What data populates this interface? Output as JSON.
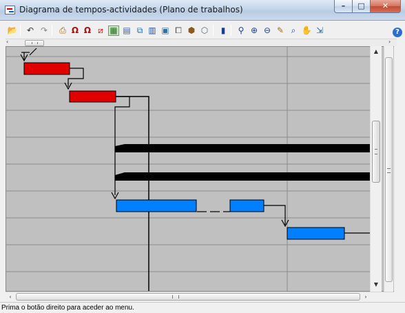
{
  "window": {
    "title": "Diagrama de tempos-actividades (Plano de trabalhos)",
    "minimize_glyph": "–",
    "maximize_glyph": "□",
    "close_glyph": "✕"
  },
  "toolbar": {
    "items": [
      {
        "name": "open-folder-icon",
        "glyph": "📂"
      },
      {
        "name": "undo-icon",
        "glyph": "↶"
      },
      {
        "name": "redo-icon",
        "glyph": "↷"
      },
      {
        "name": "print-icon",
        "glyph": "⎙"
      },
      {
        "name": "link-task-icon",
        "glyph": "Ω"
      },
      {
        "name": "unlink-task-icon",
        "glyph": "Ω"
      },
      {
        "name": "delete-link-icon",
        "glyph": "⧄"
      },
      {
        "name": "gantt-view-icon",
        "glyph": "▦"
      },
      {
        "name": "table-view-icon",
        "glyph": "▤"
      },
      {
        "name": "network-view-icon",
        "glyph": "⧉"
      },
      {
        "name": "histogram-view-icon",
        "glyph": "▥"
      },
      {
        "name": "calendar-icon",
        "glyph": "▣"
      },
      {
        "name": "copy-icon",
        "glyph": "⧠"
      },
      {
        "name": "resources-icon",
        "glyph": "⬢"
      },
      {
        "name": "box-icon",
        "glyph": "⬡"
      },
      {
        "name": "bar-chart-icon",
        "glyph": "▮"
      },
      {
        "name": "zoom-select-icon",
        "glyph": "⚲"
      },
      {
        "name": "zoom-in-icon",
        "glyph": "⊕"
      },
      {
        "name": "zoom-out-icon",
        "glyph": "⊖"
      },
      {
        "name": "pencil-icon",
        "glyph": "✎"
      },
      {
        "name": "magnify-icon",
        "glyph": "⌕"
      },
      {
        "name": "pan-hand-icon",
        "glyph": "✋"
      },
      {
        "name": "export-icon",
        "glyph": "⇲"
      }
    ],
    "help_glyph": "?"
  },
  "scrollbars": {
    "left_arrow": "‹",
    "right_arrow": "›",
    "up_arrow": "▲",
    "down_arrow": "▼",
    "bottom_left_arrow": "‹",
    "bottom_right_arrow": "›"
  },
  "gantt": {
    "colors": {
      "background": "#c0c0c0",
      "grid": "#8c8c8c",
      "critical_task": "#e00000",
      "normal_task": "#0080ff",
      "summary_task": "#000000",
      "link": "#000000"
    },
    "tasks": [
      {
        "kind": "critical"
      },
      {
        "kind": "critical"
      },
      {
        "kind": "summary"
      },
      {
        "kind": "summary"
      },
      {
        "kind": "normal"
      },
      {
        "kind": "normal"
      },
      {
        "kind": "normal"
      }
    ]
  },
  "status": {
    "text": "Prima o botão direito para aceder ao menu."
  }
}
